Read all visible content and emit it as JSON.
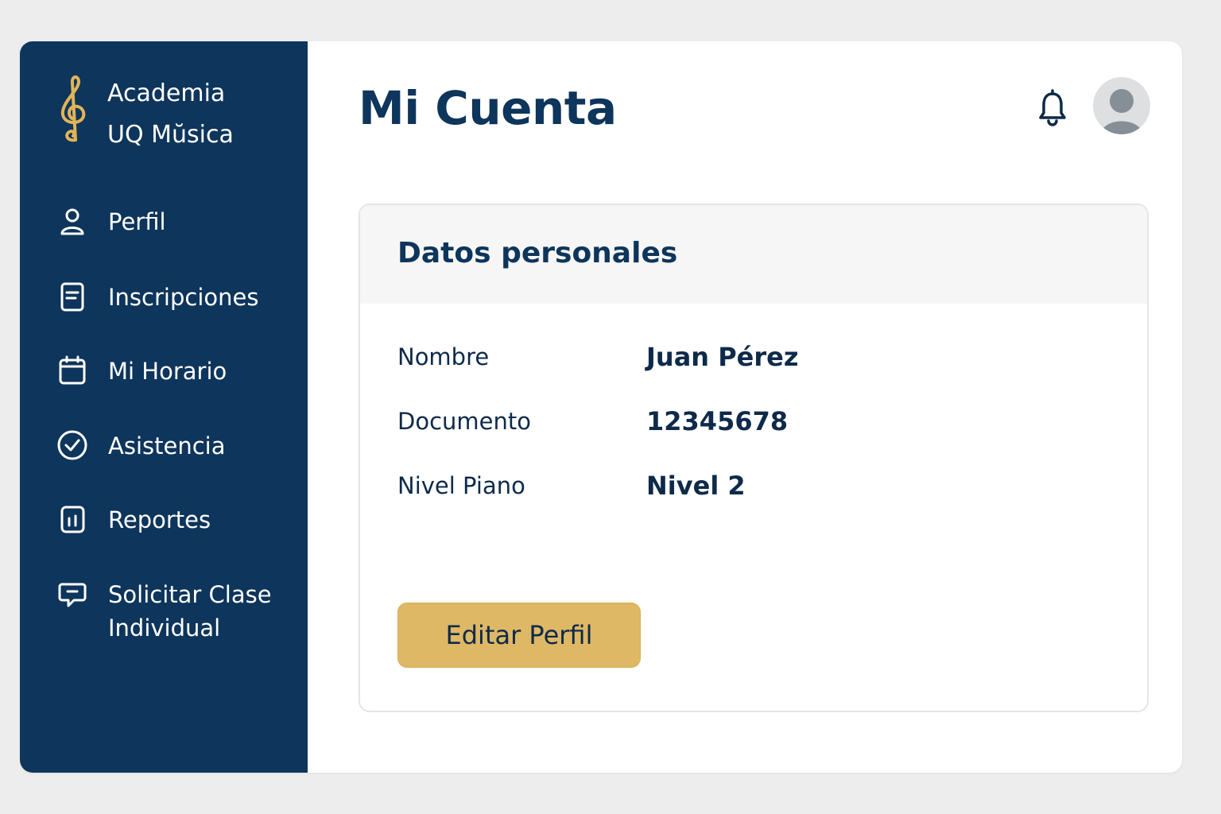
{
  "brand": {
    "line1": "Academia",
    "line2": "UQ Mŭsica",
    "icon": "treble-clef-icon",
    "color": "#e1b457"
  },
  "sidebar": {
    "items": [
      {
        "label": "Perfil",
        "icon": "user-icon"
      },
      {
        "label": "Inscripciones",
        "icon": "document-icon"
      },
      {
        "label": "Mi Horario",
        "icon": "calendar-icon"
      },
      {
        "label": "Asistencia",
        "icon": "check-circle-icon"
      },
      {
        "label": "Reportes",
        "icon": "report-icon"
      },
      {
        "label": "Solicitar Clase Individual",
        "icon": "chat-icon"
      }
    ]
  },
  "header": {
    "title": "Mi Cuenta",
    "bell_icon": "bell-icon",
    "avatar_icon": "avatar-icon"
  },
  "card": {
    "title": "Datos personales",
    "fields": [
      {
        "label": "Nombre",
        "value": "Juan Pérez"
      },
      {
        "label": "Documento",
        "value": "12345678"
      },
      {
        "label": "Nivel Piano",
        "value": "Nivel 2"
      }
    ],
    "button_label": "Editar Perfil"
  },
  "colors": {
    "sidebar": "#0e355b",
    "accent": "#dfb865",
    "background": "#ededed",
    "text": "#0e2a4a"
  }
}
